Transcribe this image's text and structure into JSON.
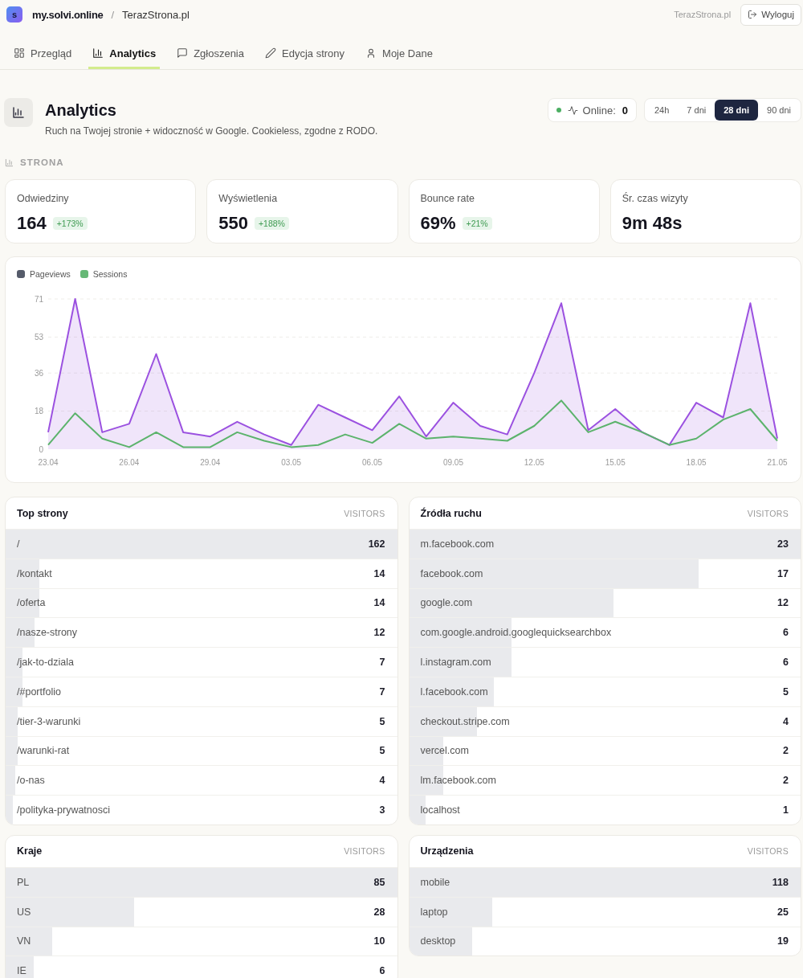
{
  "header": {
    "logo": "s",
    "site": "my.solvi.online",
    "separator": "/",
    "project": "TerazStrona.pl",
    "account": "TerazStrona.pl",
    "logout": "Wyloguj"
  },
  "nav": {
    "tabs": [
      {
        "kind": "overview",
        "label": "Przegląd",
        "selected": false
      },
      {
        "kind": "analytics",
        "label": "Analytics",
        "selected": true
      },
      {
        "kind": "tickets",
        "label": "Zgłoszenia",
        "selected": false
      },
      {
        "kind": "edit",
        "label": "Edycja strony",
        "selected": false
      },
      {
        "kind": "profile",
        "label": "Moje Dane",
        "selected": false
      }
    ]
  },
  "page": {
    "title": "Analytics",
    "subtitle": "Ruch na Twojej stronie + widoczność w Google. Cookieless, zgodne z RODO.",
    "online": {
      "label": "Online:",
      "value": "0"
    },
    "ranges": [
      {
        "label": "24h",
        "selected": false
      },
      {
        "label": "7 dni",
        "selected": false
      },
      {
        "label": "28 dni",
        "selected": true
      },
      {
        "label": "90 dni",
        "selected": false
      }
    ]
  },
  "section": {
    "label": "STRONA"
  },
  "stats": [
    {
      "label": "Odwiedziny",
      "value": "164",
      "change": "+173%"
    },
    {
      "label": "Wyświetlenia",
      "value": "550",
      "change": "+188%"
    },
    {
      "label": "Bounce rate",
      "value": "69%",
      "change": "+21%"
    },
    {
      "label": "Śr. czas wizyty",
      "value": "9m 48s"
    }
  ],
  "chart": {
    "legend": [
      {
        "color": "#555b6a"
      },
      {
        "color": "#66b876"
      }
    ],
    "chart_data": {
      "type": "line",
      "grid": true,
      "categories": [
        "23.04",
        null,
        null,
        "26.04",
        null,
        null,
        "29.04",
        null,
        null,
        "03.05",
        null,
        null,
        "06.05",
        null,
        null,
        "09.05",
        null,
        null,
        "12.05",
        null,
        null,
        "15.05",
        null,
        null,
        "18.05",
        null,
        null,
        "21.05"
      ],
      "ylim": [
        0,
        71
      ],
      "yticks": [
        0,
        18,
        36,
        53,
        71
      ],
      "series": [
        {
          "name": "Pageviews",
          "type": "area",
          "color": "#9b51e0",
          "values": [
            8,
            71,
            8,
            12,
            45,
            8,
            6,
            13,
            7,
            2,
            21,
            15,
            9,
            25,
            6,
            22,
            11,
            7,
            36,
            69,
            9,
            19,
            8,
            2,
            22,
            15,
            69,
            5
          ]
        },
        {
          "name": "Sessions",
          "type": "line",
          "color": "#5cb36c",
          "values": [
            2,
            17,
            5,
            1,
            8,
            1,
            1,
            8,
            4,
            1,
            2,
            7,
            3,
            12,
            5,
            6,
            5,
            4,
            11,
            23,
            8,
            13,
            8,
            2,
            5,
            14,
            19,
            4
          ]
        }
      ]
    }
  },
  "tables": [
    {
      "title": "Top strony",
      "column": "VISITORS",
      "rows": [
        {
          "label": "/",
          "value": "162",
          "level": 1
        },
        {
          "label": "/kontakt",
          "value": "14",
          "level": 0.086
        },
        {
          "label": "/oferta",
          "value": "14",
          "level": 0.086
        },
        {
          "label": "/nasze-strony",
          "value": "12",
          "level": 0.074
        },
        {
          "label": "/jak-to-dziala",
          "value": "7",
          "level": 0.043
        },
        {
          "label": "/#portfolio",
          "value": "7",
          "level": 0.043
        },
        {
          "label": "/tier-3-warunki",
          "value": "5",
          "level": 0.031
        },
        {
          "label": "/warunki-rat",
          "value": "5",
          "level": 0.031
        },
        {
          "label": "/o-nas",
          "value": "4",
          "level": 0.025
        },
        {
          "label": "/polityka-prywatnosci",
          "value": "3",
          "level": 0.019
        }
      ]
    },
    {
      "title": "Źródła ruchu",
      "column": "VISITORS",
      "rows": [
        {
          "label": "m.facebook.com",
          "value": "23",
          "level": 1
        },
        {
          "label": "facebook.com",
          "value": "17",
          "level": 0.739
        },
        {
          "label": "google.com",
          "value": "12",
          "level": 0.522
        },
        {
          "label": "com.google.android.googlequicksearchbox",
          "value": "6",
          "level": 0.261
        },
        {
          "label": "l.instagram.com",
          "value": "6",
          "level": 0.261
        },
        {
          "label": "l.facebook.com",
          "value": "5",
          "level": 0.217
        },
        {
          "label": "checkout.stripe.com",
          "value": "4",
          "level": 0.174
        },
        {
          "label": "vercel.com",
          "value": "2",
          "level": 0.087
        },
        {
          "label": "lm.facebook.com",
          "value": "2",
          "level": 0.087
        },
        {
          "label": "localhost",
          "value": "1",
          "level": 0.043
        }
      ]
    },
    {
      "title": "Kraje",
      "column": "VISITORS",
      "rows": [
        {
          "label": "PL",
          "value": "85",
          "level": 1
        },
        {
          "label": "US",
          "value": "28",
          "level": 0.329
        },
        {
          "label": "VN",
          "value": "10",
          "level": 0.118
        },
        {
          "label": "IE",
          "value": "6",
          "level": 0.071
        }
      ]
    },
    {
      "title": "Urządzenia",
      "column": "VISITORS",
      "rows": [
        {
          "label": "mobile",
          "value": "118",
          "level": 1
        },
        {
          "label": "laptop",
          "value": "25",
          "level": 0.212
        },
        {
          "label": "desktop",
          "value": "19",
          "level": 0.161
        }
      ]
    }
  ]
}
